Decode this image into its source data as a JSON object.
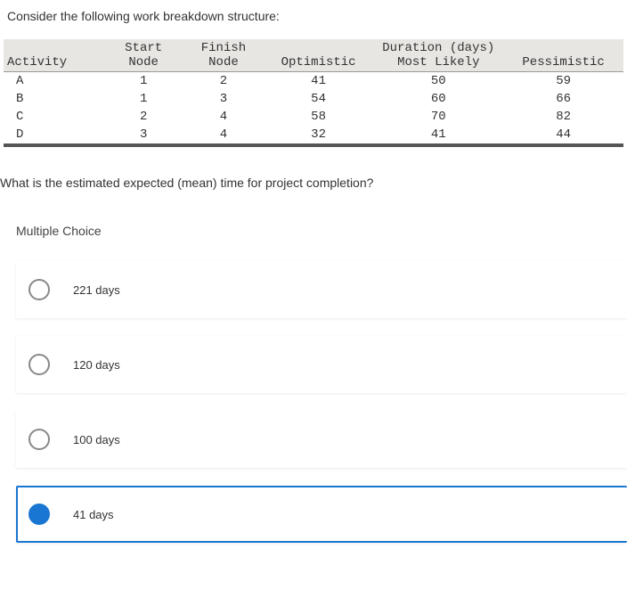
{
  "intro": "Consider the following work breakdown structure:",
  "table": {
    "headers_top": [
      "",
      "Start",
      "Finish",
      "",
      "Duration (days)",
      ""
    ],
    "headers_bot": [
      "Activity",
      "Node",
      "Node",
      "Optimistic",
      "Most Likely",
      "Pessimistic"
    ],
    "rows": [
      {
        "activity": "A",
        "start": "1",
        "finish": "2",
        "opt": "41",
        "ml": "50",
        "pess": "59"
      },
      {
        "activity": "B",
        "start": "1",
        "finish": "3",
        "opt": "54",
        "ml": "60",
        "pess": "66"
      },
      {
        "activity": "C",
        "start": "2",
        "finish": "4",
        "opt": "58",
        "ml": "70",
        "pess": "82"
      },
      {
        "activity": "D",
        "start": "3",
        "finish": "4",
        "opt": "32",
        "ml": "41",
        "pess": "44"
      }
    ]
  },
  "question": "What is the estimated expected (mean) time for project completion?",
  "mc_header": "Multiple Choice",
  "options": [
    {
      "label": "221 days",
      "selected": false
    },
    {
      "label": "120 days",
      "selected": false
    },
    {
      "label": "100 days",
      "selected": false
    },
    {
      "label": "41 days",
      "selected": true
    }
  ]
}
